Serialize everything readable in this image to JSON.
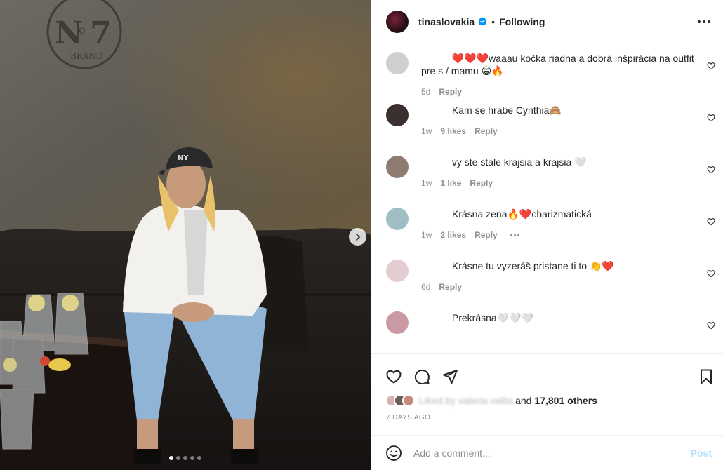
{
  "post": {
    "username": "tinaslovakia",
    "separator": "•",
    "follow_label": "Following",
    "carousel": {
      "total": 5,
      "active": 0
    }
  },
  "comments": [
    {
      "text": "❤️❤️❤️waaau kočka riadna a dobrá inšpirácia na outfit pre s  / mamu 😁🔥",
      "age": "5d",
      "likes": "",
      "reply": "Reply",
      "avatar": "#cfcfcf",
      "more": false
    },
    {
      "text": "Kam se hrabe Cynthia🙈",
      "age": "1w",
      "likes": "9 likes",
      "reply": "Reply",
      "avatar": "#3a3030",
      "more": false
    },
    {
      "text": "vy ste stale krajsia a krajsia 🤍",
      "age": "1w",
      "likes": "1 like",
      "reply": "Reply",
      "avatar": "#8e7c72",
      "more": false
    },
    {
      "text": "Krásna zena🔥❤️charizmatická",
      "age": "1w",
      "likes": "2 likes",
      "reply": "Reply",
      "avatar": "#9fbfc4",
      "more": true
    },
    {
      "text": "Krásne tu vyzeráš pristane ti to 👏❤️",
      "age": "6d",
      "likes": "",
      "reply": "Reply",
      "avatar": "#e3cdd0",
      "more": false
    },
    {
      "text": "Prekrásna🤍🤍🤍",
      "age": "",
      "likes": "",
      "reply": "",
      "avatar": "#c99aa4",
      "more": false
    }
  ],
  "likes": {
    "prefix": "Liked by valeria.vallia",
    "connector": "and",
    "count": "17,801 others"
  },
  "timestamp": "7 DAYS AGO",
  "composer": {
    "placeholder": "Add a comment...",
    "post_label": "Post"
  },
  "colors": {
    "verified": "#0095f6",
    "post_disabled": "#b2dffc",
    "meta": "#8e8e8e"
  }
}
